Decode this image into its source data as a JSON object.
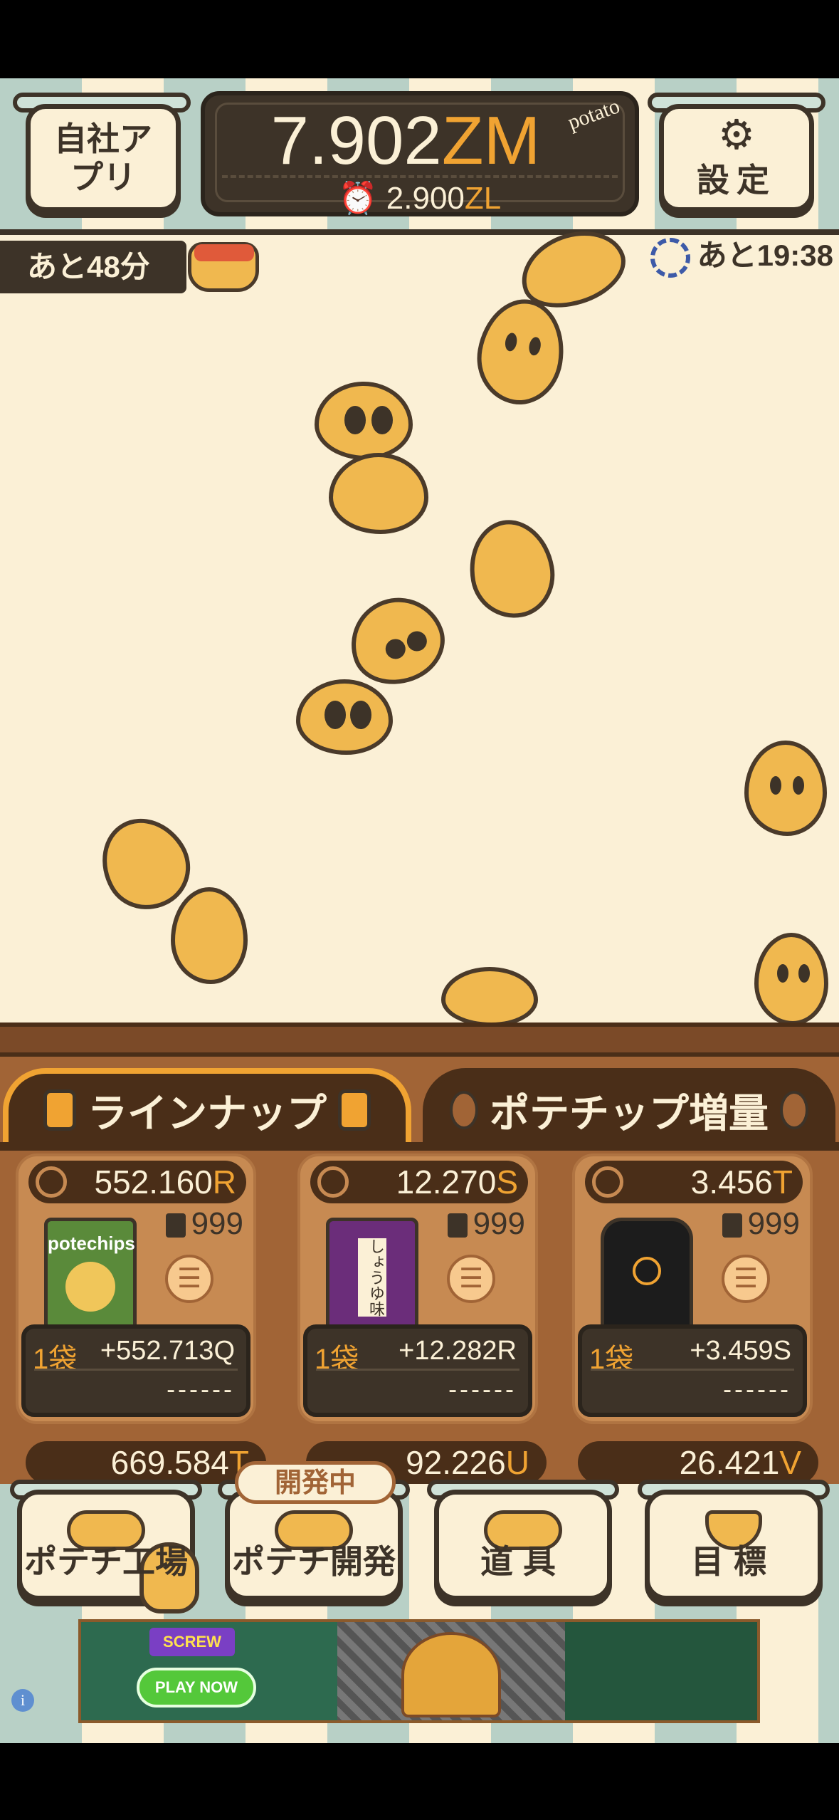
{
  "header": {
    "company_apps_label": "自社アプリ",
    "settings_label": "設定",
    "total_value": "7.902",
    "total_unit": "ZM",
    "rate_value": "2.900",
    "rate_unit": "ZL",
    "brand_text": "potato"
  },
  "timers": {
    "left_text": "あと48分",
    "right_text": "あと19:38"
  },
  "tabs": [
    {
      "label": "ラインナップ",
      "active": true
    },
    {
      "label": "ポテチップ増量",
      "active": false
    }
  ],
  "products": [
    {
      "rate_value": "552.160",
      "rate_unit": "R",
      "stock": "999",
      "product_name": "potechips",
      "qty_label": "1袋",
      "gain": "+552.713Q",
      "cost": "------"
    },
    {
      "rate_value": "12.270",
      "rate_unit": "S",
      "stock": "999",
      "product_name": "しょうゆ味",
      "qty_label": "1袋",
      "gain": "+12.282R",
      "cost": "------"
    },
    {
      "rate_value": "3.456",
      "rate_unit": "T",
      "stock": "999",
      "product_name": "",
      "qty_label": "1袋",
      "gain": "+3.459S",
      "cost": "------"
    }
  ],
  "products_row2": [
    {
      "rate_value": "669.584",
      "rate_unit": "T"
    },
    {
      "rate_value": "92.226",
      "rate_unit": "U"
    },
    {
      "rate_value": "26.421",
      "rate_unit": "V"
    }
  ],
  "nav": {
    "potechi_label": "ポテチ工場",
    "dev_label": "ポテチ開発",
    "dev_badge": "開発中",
    "tools_label": "道具",
    "goal_label": "目標"
  },
  "ad": {
    "logo_text": "SCREW",
    "play_label": "PLAY NOW",
    "info_icon": "i"
  },
  "colors": {
    "accent": "#f0a332",
    "dark": "#3d3328",
    "cream": "#fbf0d6",
    "mint": "#b8d0c6"
  }
}
